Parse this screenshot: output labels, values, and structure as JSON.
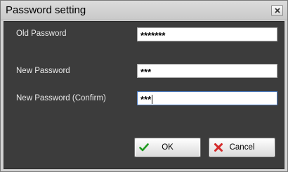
{
  "window": {
    "title": "Password setting"
  },
  "form": {
    "old_password": {
      "label": "Old Password",
      "value": "*******"
    },
    "new_password": {
      "label": "New Password",
      "value": "***"
    },
    "confirm_password": {
      "label": "New Password (Confirm)",
      "value": "***"
    }
  },
  "buttons": {
    "ok": {
      "label": "OK",
      "icon": "check-icon"
    },
    "cancel": {
      "label": "Cancel",
      "icon": "x-icon"
    }
  }
}
